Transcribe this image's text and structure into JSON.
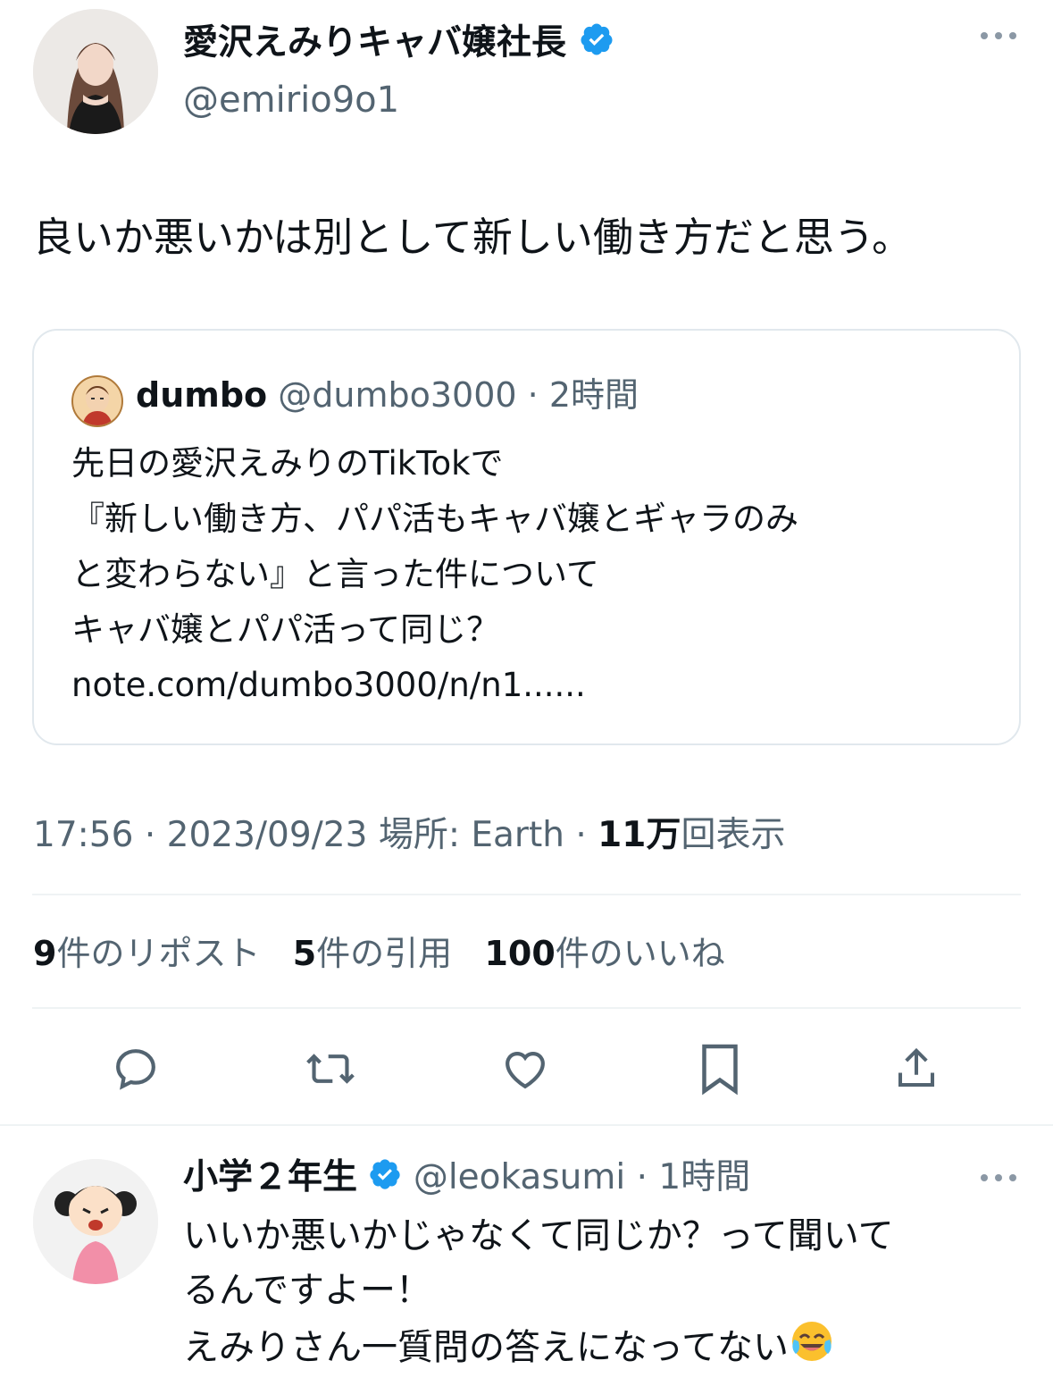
{
  "tweet": {
    "author_name": "愛沢えみりキャバ嬢社長",
    "author_handle": "@emirio9o1",
    "text": "良いか悪いかは別として新しい働き方だと思う。",
    "quoted": {
      "author_name": "dumbo",
      "author_handle": "@dumbo3000",
      "time": "· 2時間",
      "text": "先日の愛沢えみりのTikTokで\n『新しい働き方、パパ活もキャバ嬢とギャラのみ\nと変わらない』と言った件について\nキャバ嬢とパパ活って同じ？\nnote.com/dumbo3000/n/n1......"
    },
    "meta": {
      "time": "17:56",
      "date": "2023/09/23",
      "location_label": "場所: Earth",
      "views_count": "11万",
      "views_label": "回表示"
    },
    "stats": [
      {
        "count": "9",
        "label": "件のリポスト"
      },
      {
        "count": "5",
        "label": "件の引用"
      },
      {
        "count": "100",
        "label": "件のいいね"
      }
    ],
    "actions": [
      "reply-icon",
      "retweet-icon",
      "like-icon",
      "bookmark-icon",
      "share-icon"
    ]
  },
  "reply": {
    "author_name": "小学２年生",
    "author_handle": "@leokasumi",
    "time": "· 1時間",
    "text": "いいか悪いかじゃなくて同じか？って聞いて\nるんですよー！\nえみりさん一質問の答えになってない"
  },
  "colors": {
    "verified": "#1d9bf0",
    "secondary_text": "#536471",
    "divider": "#eff3f4"
  }
}
